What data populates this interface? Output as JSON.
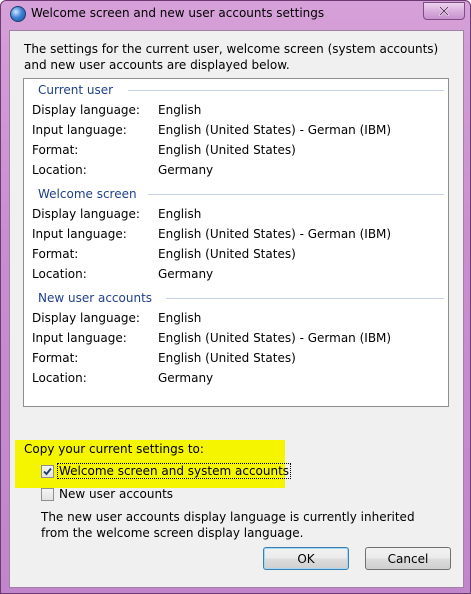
{
  "window": {
    "title": "Welcome screen and new user accounts settings",
    "close_label": "×"
  },
  "intro": "The settings for the current user, welcome screen (system accounts) and new user accounts are displayed below.",
  "sections": [
    {
      "header": "Current user",
      "rows": [
        {
          "label": "Display language:",
          "value": "English"
        },
        {
          "label": "Input language:",
          "value": "English (United States) - German (IBM)"
        },
        {
          "label": "Format:",
          "value": "English (United States)"
        },
        {
          "label": "Location:",
          "value": "Germany"
        }
      ]
    },
    {
      "header": "Welcome screen",
      "rows": [
        {
          "label": "Display language:",
          "value": "English"
        },
        {
          "label": "Input language:",
          "value": "English (United States) - German (IBM)"
        },
        {
          "label": "Format:",
          "value": "English (United States)"
        },
        {
          "label": "Location:",
          "value": "Germany"
        }
      ]
    },
    {
      "header": "New user accounts",
      "rows": [
        {
          "label": "Display language:",
          "value": "English"
        },
        {
          "label": "Input language:",
          "value": "English (United States) - German (IBM)"
        },
        {
          "label": "Format:",
          "value": "English (United States)"
        },
        {
          "label": "Location:",
          "value": "Germany"
        }
      ]
    }
  ],
  "copy": {
    "label": "Copy your current settings to:",
    "welcome_checkbox": {
      "label": "Welcome screen and system accounts",
      "checked": true
    },
    "new_user_checkbox": {
      "label": "New user accounts",
      "checked": false
    }
  },
  "note": "The new user accounts display language is currently inherited from the welcome screen display language.",
  "buttons": {
    "ok": "OK",
    "cancel": "Cancel"
  },
  "colors": {
    "frame": "#c98ed0",
    "section_header": "#1e3f8a",
    "highlight": "#f6f500"
  }
}
